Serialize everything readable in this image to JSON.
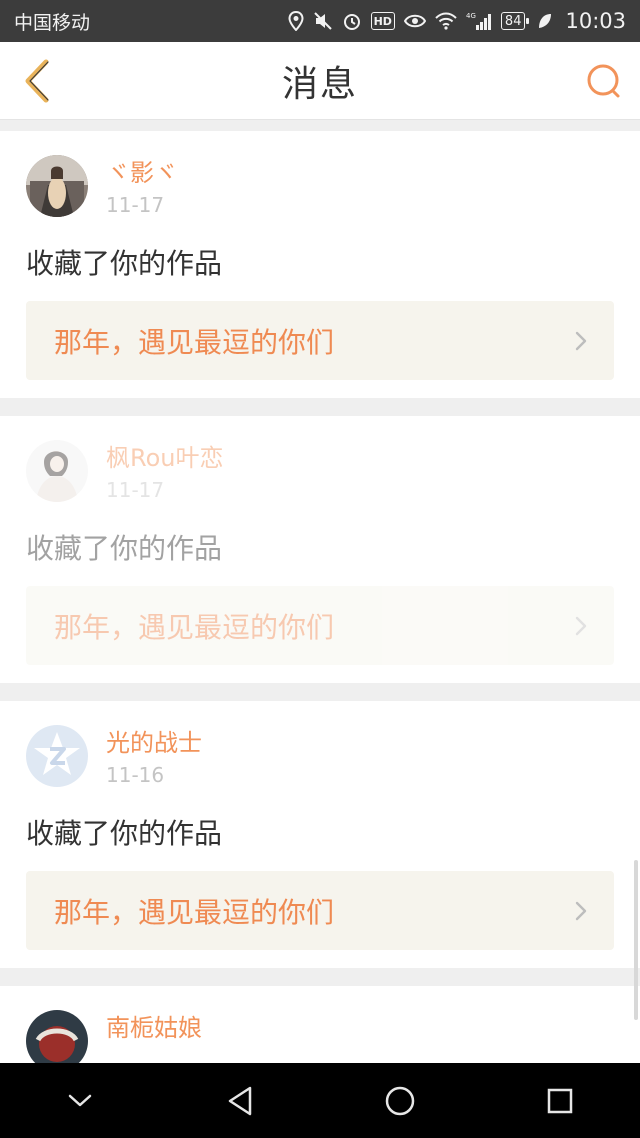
{
  "status_bar": {
    "carrier": "中国移动",
    "network": "4G",
    "battery": "84",
    "time": "10:03"
  },
  "header": {
    "title": "消息",
    "back_icon": "chevron-left-icon",
    "search_icon": "search-icon"
  },
  "colors": {
    "accent": "#f2935a",
    "link_bg": "#f6f4ed",
    "link_text": "#ef8a52"
  },
  "notifications": [
    {
      "user": "ヾ影ヾ",
      "date": "11-17",
      "action": "收藏了你的作品",
      "work": "那年，遇见最逗的你们"
    },
    {
      "user": "枫Rou叶恋",
      "date": "11-17",
      "action": "收藏了你的作品",
      "work": "那年，遇见最逗的你们"
    },
    {
      "user": "光的战士",
      "date": "11-16",
      "action": "收藏了你的作品",
      "work": "那年，遇见最逗的你们"
    },
    {
      "user": "南栀姑娘"
    }
  ]
}
